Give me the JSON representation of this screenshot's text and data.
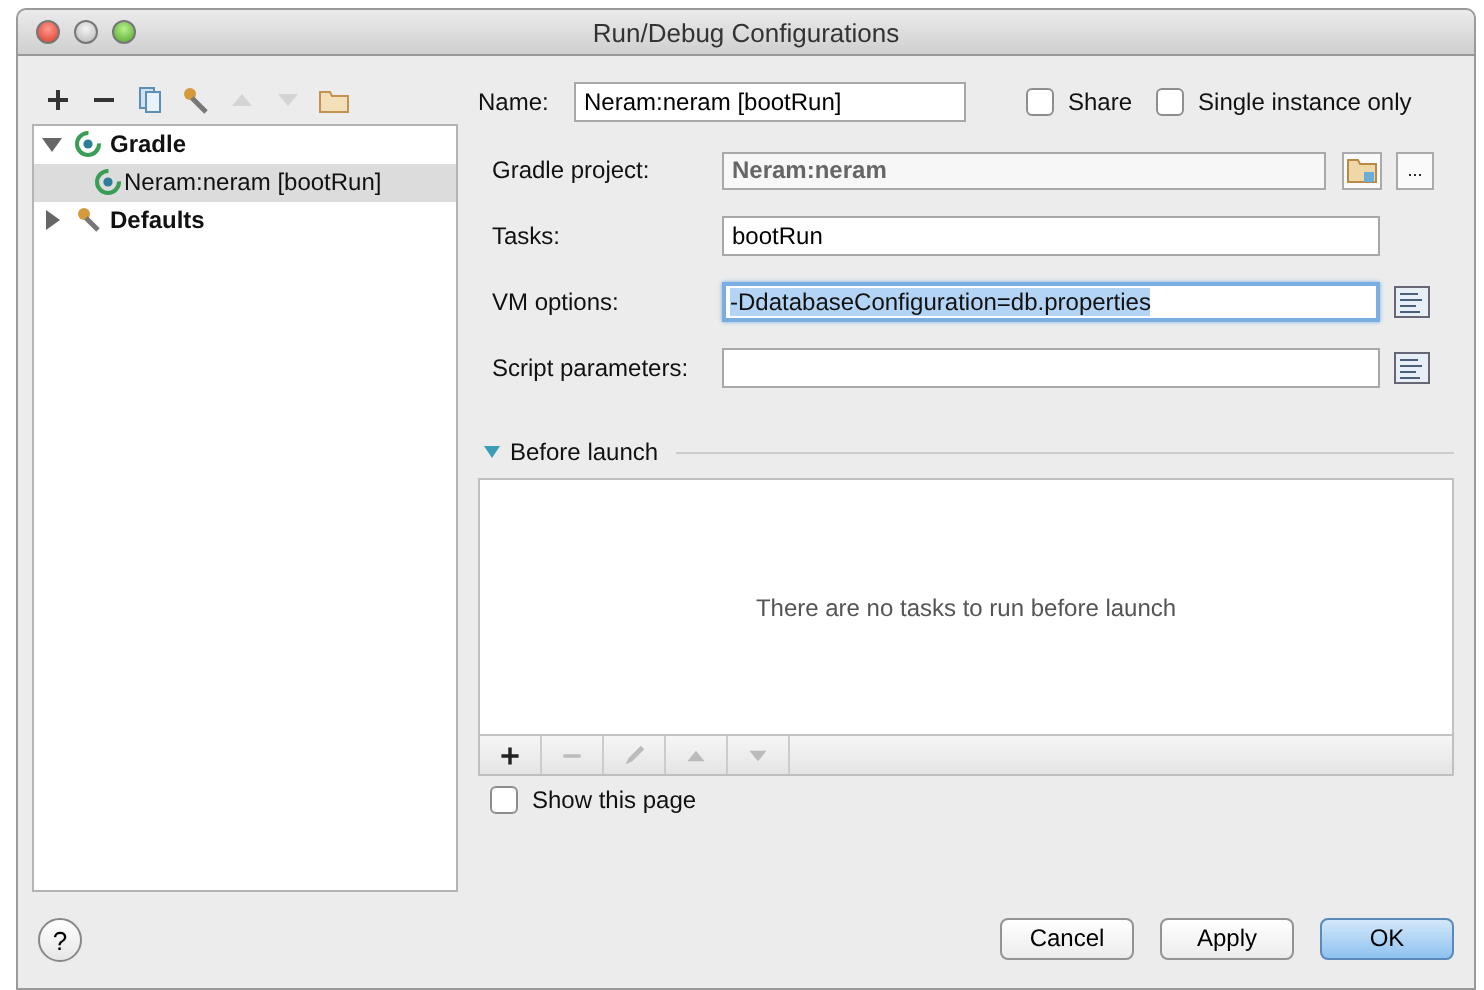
{
  "window": {
    "title": "Run/Debug Configurations"
  },
  "toolbar": [
    {
      "kind": "add",
      "disabled": false
    },
    {
      "kind": "remove",
      "disabled": false
    },
    {
      "kind": "copy",
      "disabled": false
    },
    {
      "kind": "wrench",
      "disabled": false
    },
    {
      "kind": "up",
      "disabled": true
    },
    {
      "kind": "down",
      "disabled": true
    },
    {
      "kind": "folder",
      "disabled": false
    }
  ],
  "tree": [
    {
      "label": "Gradle",
      "expanded": true,
      "selected": false,
      "children": [
        {
          "label": "Neram:neram [bootRun]",
          "selected": true
        }
      ]
    },
    {
      "label": "Defaults",
      "expanded": false,
      "selected": false
    }
  ],
  "name": {
    "label": "Name:",
    "value": "Neram:neram [bootRun]"
  },
  "options": [
    {
      "label": "Share",
      "checked": false
    },
    {
      "label": "Single instance only",
      "checked": false
    }
  ],
  "fields": [
    {
      "kind": "project",
      "label": "Gradle project:",
      "value": "Neram:neram",
      "browse": "..."
    },
    {
      "kind": "text",
      "label": "Tasks:",
      "value": "bootRun"
    },
    {
      "kind": "expand",
      "label": "VM options:",
      "value": "-DdatabaseConfiguration=db.properties",
      "focused": true
    },
    {
      "kind": "expand",
      "label": "Script parameters:",
      "focused": false
    }
  ],
  "before_launch": {
    "title": "Before launch",
    "expanded": true,
    "empty_text": "There are no tasks to run before launch",
    "toolbar": [
      {
        "kind": "add",
        "disabled": false
      },
      {
        "kind": "remove",
        "disabled": true
      },
      {
        "kind": "edit",
        "disabled": true
      },
      {
        "kind": "up",
        "disabled": true
      },
      {
        "kind": "down",
        "disabled": true
      }
    ],
    "show_page": {
      "label": "Show this page",
      "checked": false
    }
  },
  "help": "?",
  "buttons": [
    {
      "label": "Cancel",
      "default": false
    },
    {
      "label": "Apply",
      "default": false
    },
    {
      "label": "OK",
      "default": true
    }
  ]
}
